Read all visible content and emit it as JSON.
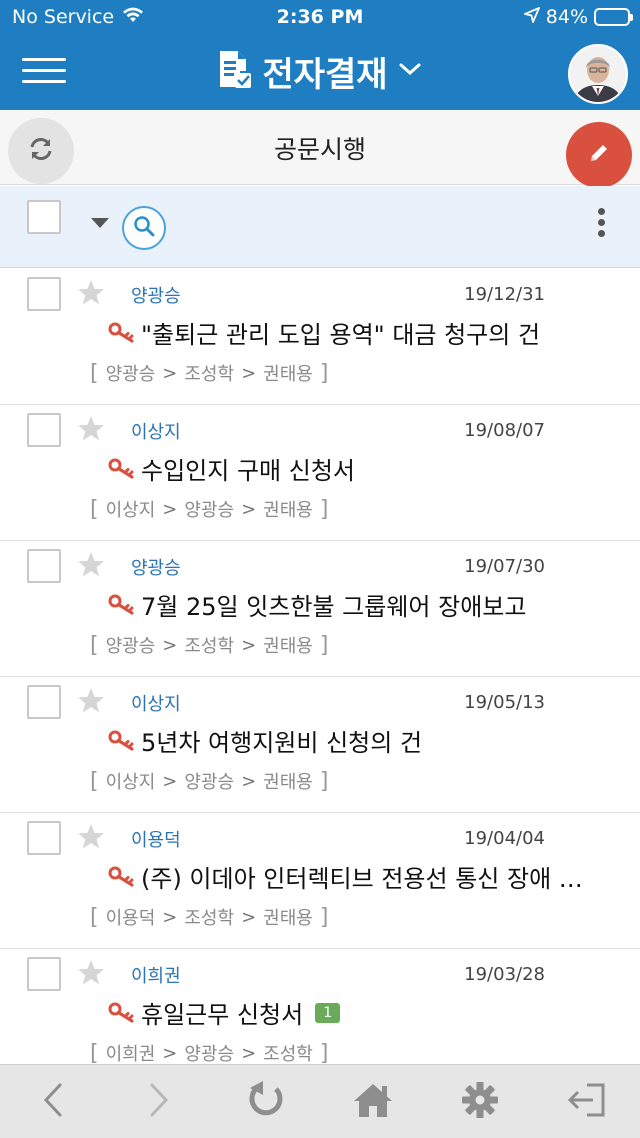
{
  "status_bar": {
    "carrier": "No Service",
    "time": "2:36 PM",
    "battery": "84%",
    "battery_level": 0.84
  },
  "header": {
    "title": "전자결재"
  },
  "subheader": {
    "title": "공문시행"
  },
  "documents": [
    {
      "author": "양광승",
      "date": "19/12/31",
      "subject": "\"출퇴근 관리 도입 용역\" 대금 청구의 건",
      "badge": "",
      "line": [
        "양광승",
        "조성학",
        "권태용"
      ]
    },
    {
      "author": "이상지",
      "date": "19/08/07",
      "subject": "수입인지 구매 신청서",
      "badge": "",
      "line": [
        "이상지",
        "양광승",
        "권태용"
      ]
    },
    {
      "author": "양광승",
      "date": "19/07/30",
      "subject": "7월 25일 잇츠한불 그룹웨어 장애보고",
      "badge": "",
      "line": [
        "양광승",
        "조성학",
        "권태용"
      ]
    },
    {
      "author": "이상지",
      "date": "19/05/13",
      "subject": "5년차 여행지원비 신청의 건",
      "badge": "",
      "line": [
        "이상지",
        "양광승",
        "권태용"
      ]
    },
    {
      "author": "이용덕",
      "date": "19/04/04",
      "subject": "(주) 이데아 인터렉티브 전용선 통신 장애 장애보고",
      "badge": "",
      "line": [
        "이용덕",
        "조성학",
        "권태용"
      ]
    },
    {
      "author": "이희권",
      "date": "19/03/28",
      "subject": "휴일근무 신청서",
      "badge": "1",
      "line": [
        "이희권",
        "양광승",
        "조성학"
      ]
    }
  ],
  "colors": {
    "primary": "#1f7ec2",
    "compose": "#d9503f",
    "author": "#2a74b6",
    "badge": "#6aab5a",
    "key": "#d9503f"
  }
}
